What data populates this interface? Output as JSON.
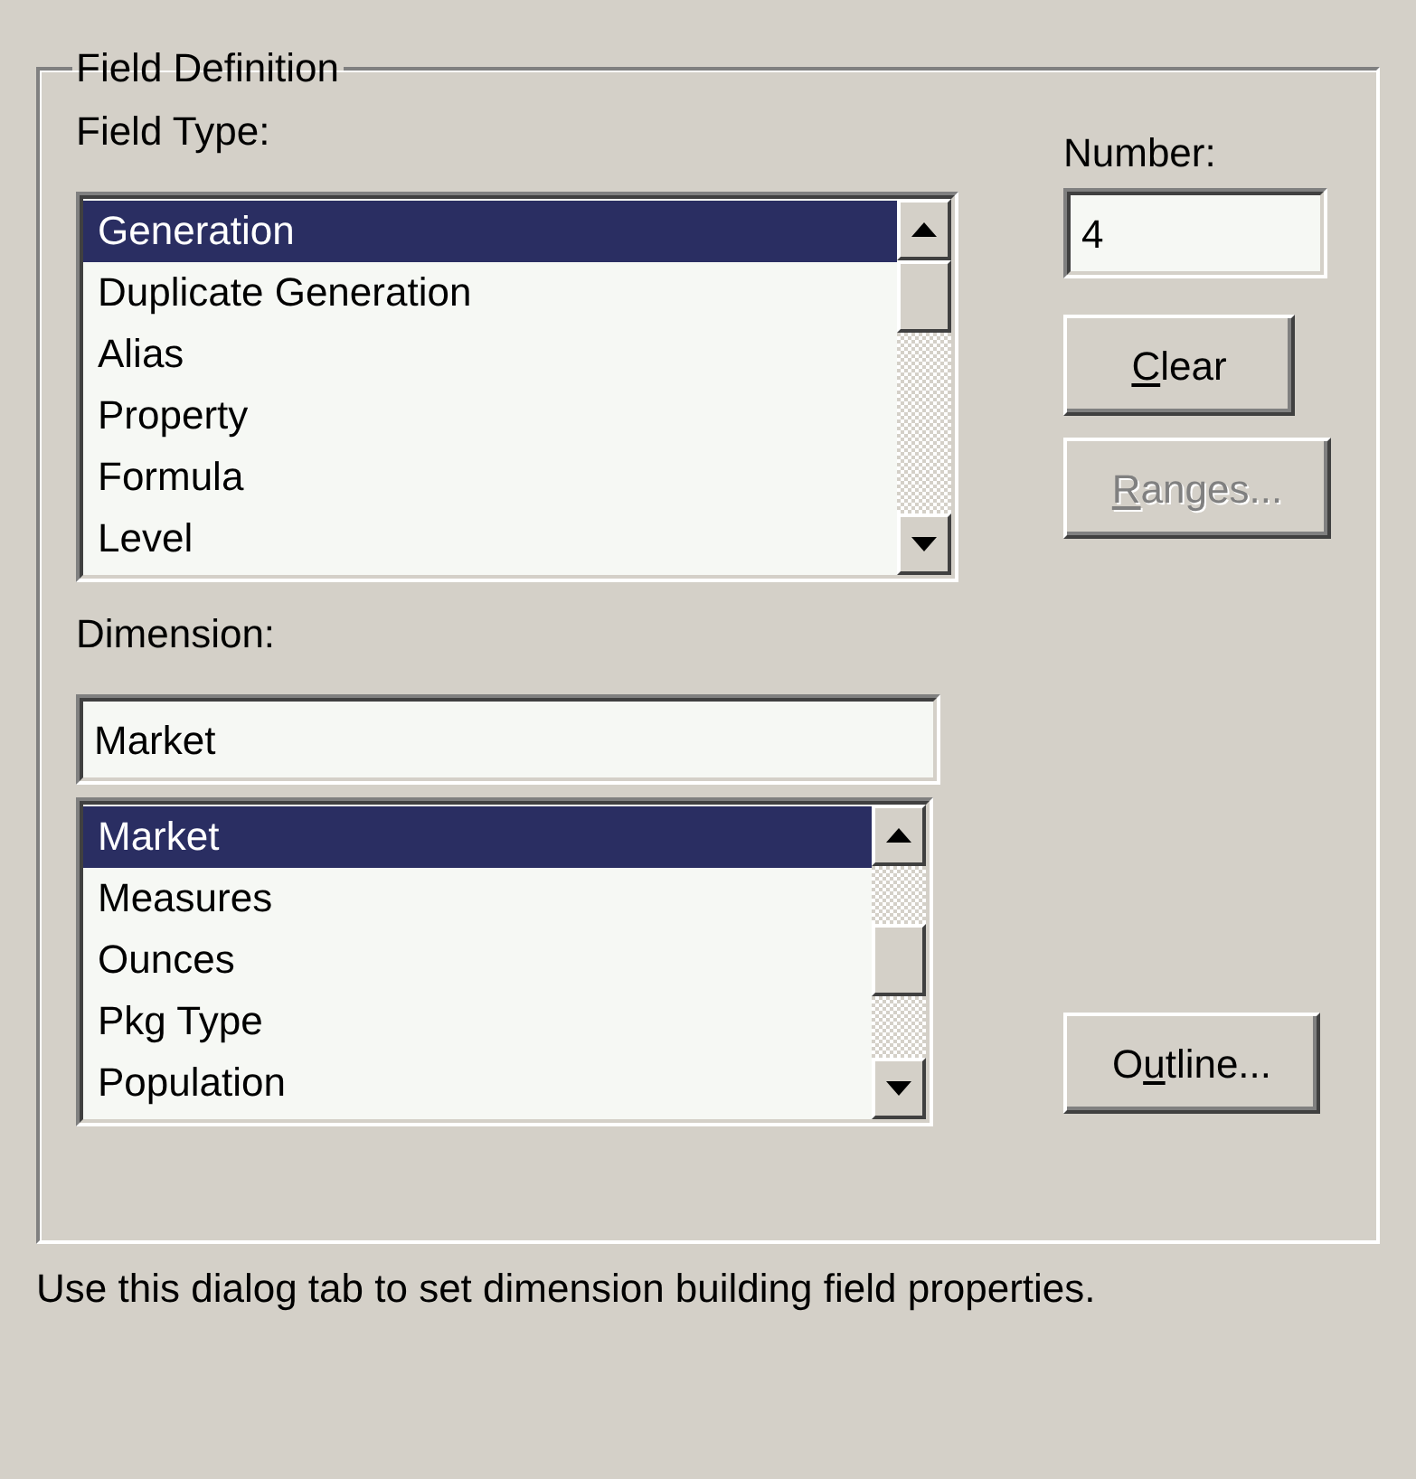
{
  "group": {
    "title": "Field Definition"
  },
  "field_type": {
    "label": "Field Type:",
    "items": [
      {
        "label": "Generation",
        "selected": true
      },
      {
        "label": "Duplicate Generation",
        "selected": false
      },
      {
        "label": "Alias",
        "selected": false
      },
      {
        "label": "Property",
        "selected": false
      },
      {
        "label": "Formula",
        "selected": false
      },
      {
        "label": "Level",
        "selected": false
      }
    ]
  },
  "number": {
    "label": "Number:",
    "value": "4"
  },
  "buttons": [
    {
      "parts": [
        {
          "text": "C",
          "underline": true
        },
        {
          "text": "lear",
          "underline": false
        }
      ],
      "disabled": false
    },
    {
      "parts": [
        {
          "text": "R",
          "underline": true
        },
        {
          "text": "anges...",
          "underline": false
        }
      ],
      "disabled": true
    }
  ],
  "dimension": {
    "label": "Dimension:",
    "value": "Market",
    "items": [
      {
        "label": "Market",
        "selected": true
      },
      {
        "label": "Measures",
        "selected": false
      },
      {
        "label": "Ounces",
        "selected": false
      },
      {
        "label": "Pkg Type",
        "selected": false
      },
      {
        "label": "Population",
        "selected": false
      }
    ]
  },
  "outline_button": {
    "parts": [
      {
        "text": "O",
        "underline": false
      },
      {
        "text": "u",
        "underline": true
      },
      {
        "text": "tline...",
        "underline": false
      }
    ],
    "disabled": false
  },
  "hint": "Use this dialog tab to set dimension building field properties."
}
